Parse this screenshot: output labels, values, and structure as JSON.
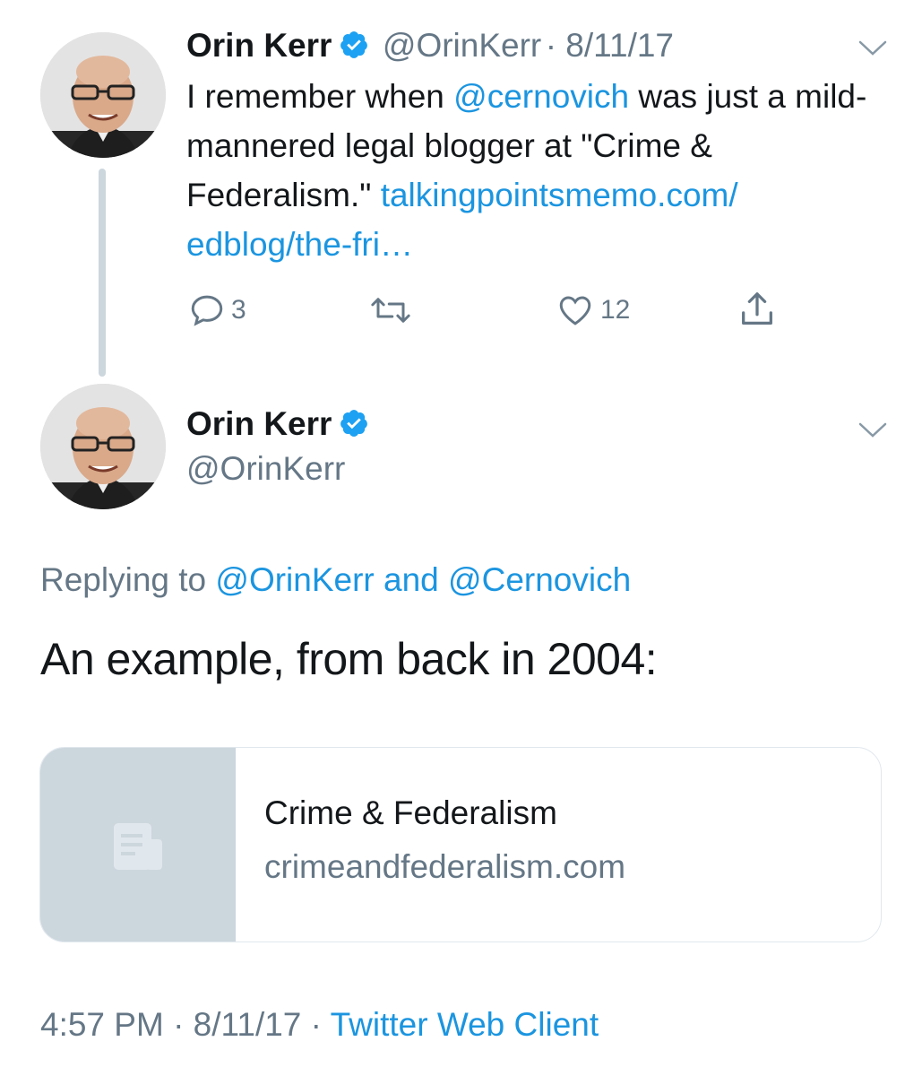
{
  "tweet1": {
    "author_name": "Orin Kerr",
    "handle": "@OrinKerr",
    "date": "· 8/11/17",
    "text_pre": "I remember when ",
    "mention": "@cernovich",
    "text_mid": " was just a mild-mannered legal blogger at \"Crime & Federalism.\" ",
    "link": "talkingpointsmemo.com/ edblog/the-fri…",
    "reply_count": "3",
    "like_count": "12"
  },
  "tweet2": {
    "author_name": "Orin Kerr",
    "handle": "@OrinKerr",
    "replying_prefix": "Replying to ",
    "replying_targets": "@OrinKerr and @Cernovich",
    "text": "An example, from back in 2004:",
    "card": {
      "title": "Crime & Federalism",
      "domain": "crimeandfederalism.com"
    },
    "time": "4:57 PM",
    "date": "· 8/11/17 ·",
    "client": "Twitter Web Client"
  },
  "icons": {
    "verified": "verified-badge-icon",
    "chevron": "chevron-down-icon",
    "reply": "reply-icon",
    "retweet": "retweet-icon",
    "like": "heart-icon",
    "share": "share-icon",
    "card_placeholder": "document-icon"
  },
  "colors": {
    "link": "#1b95e0",
    "verified": "#1da1f2",
    "muted": "#657786",
    "thread_line": "#ccd6dd"
  }
}
